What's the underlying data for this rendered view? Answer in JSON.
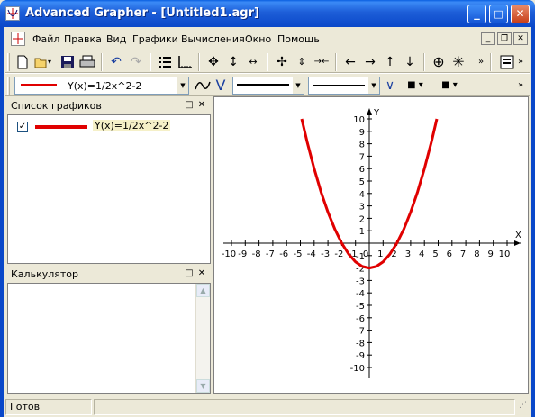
{
  "window": {
    "title": "Advanced Grapher - [Untitled1.agr]",
    "minimize_glyph": "_",
    "maximize_glyph": "□",
    "close_glyph": "✕"
  },
  "menu": {
    "items": [
      "Файл",
      "Правка",
      "Вид",
      "Графики",
      "Вычисления",
      "Окно",
      "Помощь"
    ],
    "mdi_minimize": "_",
    "mdi_restore": "❐",
    "mdi_close": "✕"
  },
  "toolbar1": {
    "icons": [
      "new-icon",
      "open-icon",
      "save-icon",
      "print-icon",
      "undo-icon",
      "redo-icon",
      "graph-list-icon",
      "axes-icon",
      "move-all-icon",
      "move-vertical-icon",
      "shrink-horizontal-icon",
      "zoom-in-icon",
      "zoom-vertical-icon",
      "zoom-horizontal-icon",
      "left-arrow-icon",
      "right-arrow-icon",
      "up-arrow-icon",
      "down-arrow-icon",
      "cross-icon",
      "star-icon",
      "more-icon",
      "settings-icon"
    ]
  },
  "toolbar2": {
    "graph_select_value": "Y(x)=1/2x^2-2",
    "graph_color": "#e00000"
  },
  "graph_list_panel": {
    "title": "Список графиков",
    "items": [
      {
        "label": "Y(x)=1/2x^2-2",
        "checked": true,
        "color": "#e00000"
      }
    ]
  },
  "calculator_panel": {
    "title": "Калькулятор"
  },
  "status": {
    "text": "Готов"
  },
  "chart_data": {
    "type": "line",
    "function": "Y(x)=1/2x^2-2",
    "xlabel": "X",
    "ylabel": "Y",
    "xlim": [
      -10,
      10
    ],
    "ylim": [
      -10,
      10
    ],
    "x_ticks": [
      -10,
      -9,
      -8,
      -7,
      -6,
      -5,
      -4,
      -3,
      -2,
      -1,
      0,
      1,
      2,
      3,
      4,
      5,
      6,
      7,
      8,
      9,
      10
    ],
    "y_ticks": [
      -10,
      -9,
      -8,
      -7,
      -6,
      -5,
      -4,
      -3,
      -2,
      -1,
      1,
      2,
      3,
      4,
      5,
      6,
      7,
      8,
      9,
      10
    ],
    "x": [
      -4.9,
      -4.5,
      -4,
      -3.5,
      -3,
      -2.5,
      -2,
      -1.5,
      -1,
      -0.5,
      0,
      0.5,
      1,
      1.5,
      2,
      2.5,
      3,
      3.5,
      4,
      4.5,
      4.9
    ],
    "y": [
      10.0,
      8.125,
      6,
      4.125,
      2.5,
      1.125,
      0,
      -0.875,
      -1.5,
      -1.875,
      -2,
      -1.875,
      -1.5,
      -0.875,
      0,
      1.125,
      2.5,
      4.125,
      6,
      8.125,
      10.0
    ],
    "series": [
      {
        "name": "Y(x)=1/2x^2-2",
        "color": "#e00000"
      }
    ],
    "grid": false
  }
}
